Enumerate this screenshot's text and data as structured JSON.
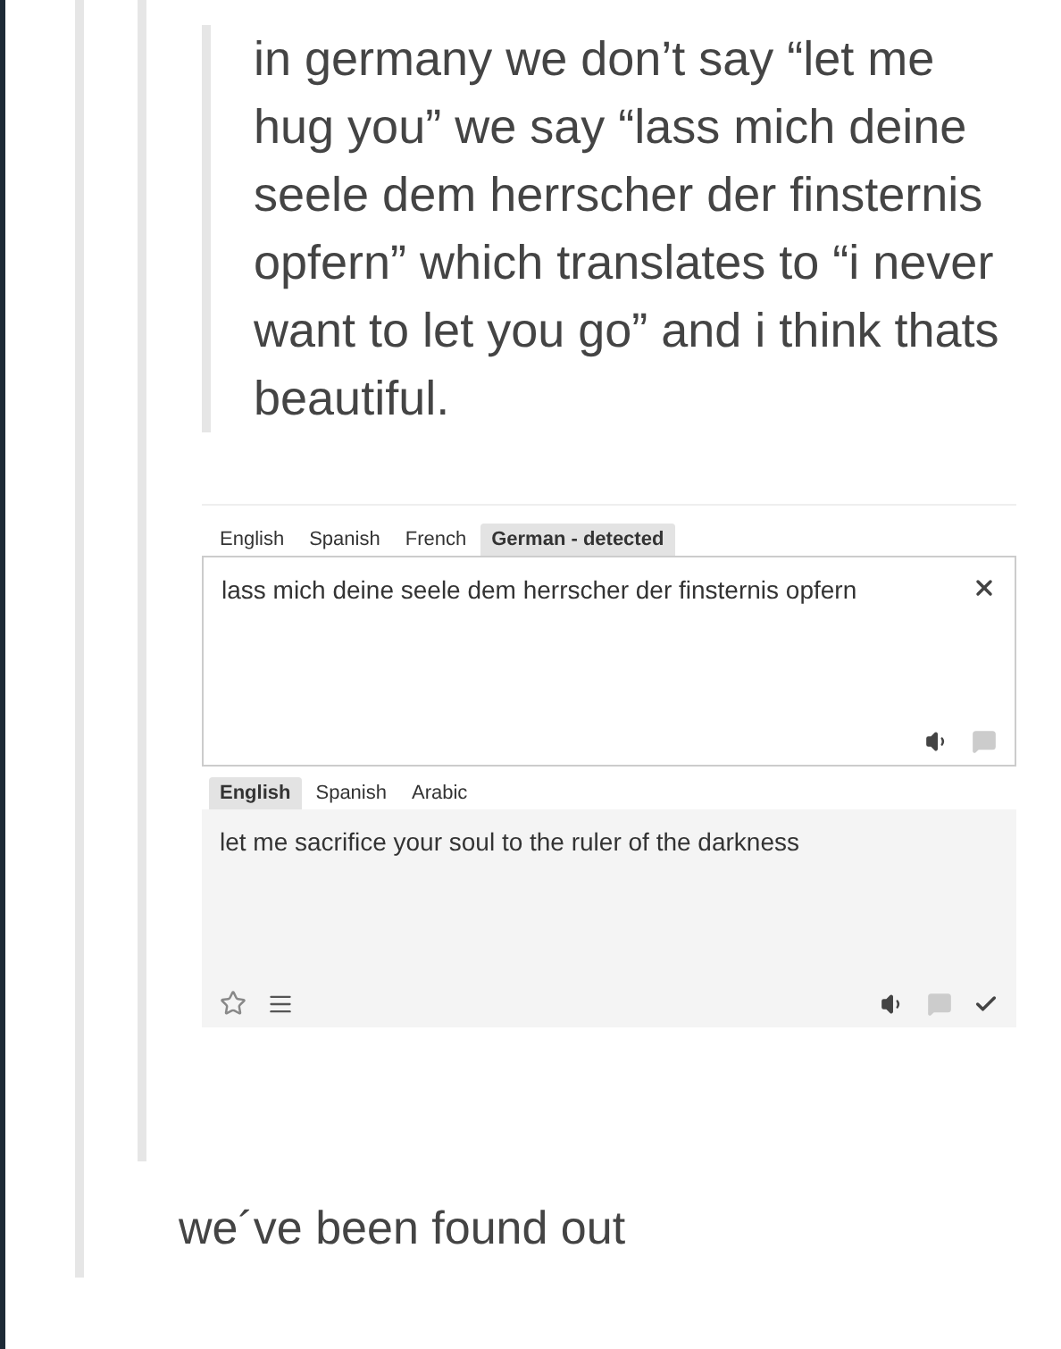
{
  "quote": "in germany we don’t say “let me hug you” we say “lass mich deine seele dem herrscher der finsternis opfern” which translates to “i never want to let you go” and i think thats beautiful.",
  "translator": {
    "source": {
      "tabs": [
        {
          "label": "English",
          "selected": false
        },
        {
          "label": "Spanish",
          "selected": false
        },
        {
          "label": "French",
          "selected": false
        },
        {
          "label": "German - detected",
          "selected": true
        }
      ],
      "text": "lass mich deine seele dem herrscher der finsternis opfern"
    },
    "target": {
      "tabs": [
        {
          "label": "English",
          "selected": true
        },
        {
          "label": "Spanish",
          "selected": false
        },
        {
          "label": "Arabic",
          "selected": false
        }
      ],
      "text": "let me sacrifice your soul to the ruler of the darkness"
    }
  },
  "caption": "we´ve been found out"
}
